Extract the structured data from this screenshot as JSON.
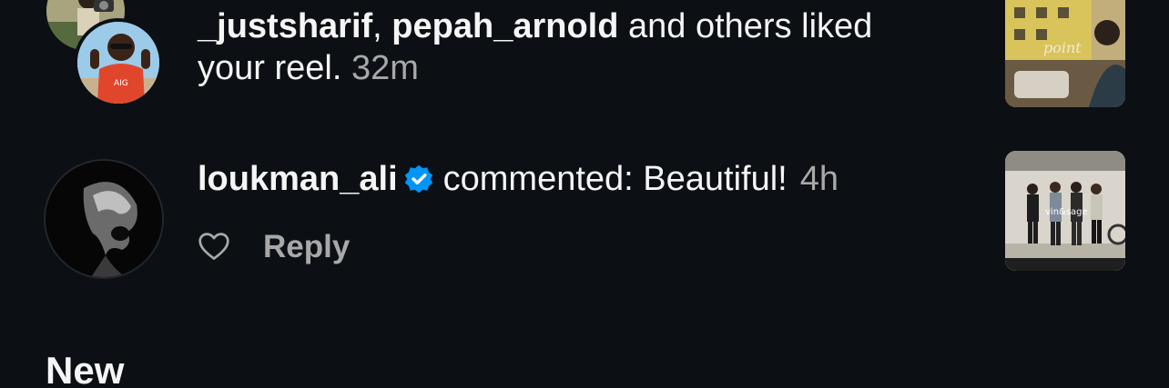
{
  "notifications": [
    {
      "user1": "_justsharif",
      "separator": ",",
      "user2": "pepah_arnold",
      "action_line1": "and others liked",
      "action_line2": "your reel.",
      "time": "32m",
      "thumbnail_caption": "point"
    },
    {
      "user": "loukman_ali",
      "action": "commented: Beautiful!",
      "time": "4h",
      "reply_label": "Reply",
      "thumbnail_caption": "vin&sage"
    }
  ],
  "section": {
    "title": "New"
  },
  "colors": {
    "background": "#0c1014",
    "text": "#f5f5f5",
    "muted": "#a8a8a8",
    "verified": "#0095f6"
  }
}
